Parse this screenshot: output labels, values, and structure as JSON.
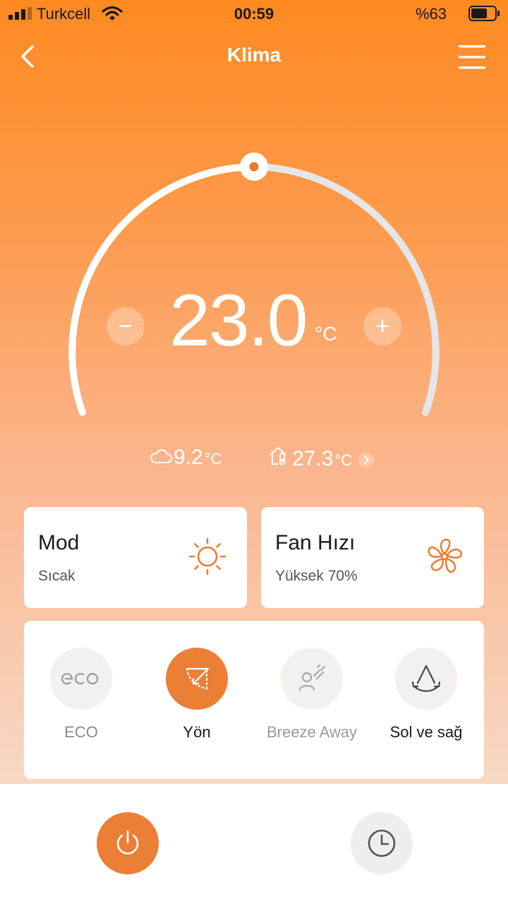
{
  "status_bar": {
    "carrier": "Turkcell",
    "time": "00:59",
    "battery": "%63"
  },
  "header": {
    "title": "Klima"
  },
  "thermostat": {
    "temperature": "23.0",
    "unit": "°C",
    "minus": "−",
    "plus": "+"
  },
  "environment": {
    "outdoor_temp": "9.2",
    "outdoor_unit": "°C",
    "indoor_temp": "27.3",
    "indoor_unit": "°C"
  },
  "mode_card": {
    "title": "Mod",
    "value": "Sıcak",
    "icon": "sun-icon"
  },
  "fan_card": {
    "title": "Fan Hızı",
    "value": "Yüksek 70%",
    "icon": "fan-icon"
  },
  "functions": [
    {
      "label": "ECO",
      "icon": "eco-icon",
      "active": false
    },
    {
      "label": "Yön",
      "icon": "direction-icon",
      "active": true
    },
    {
      "label": "Breeze Away",
      "icon": "breeze-away-icon",
      "active": false
    },
    {
      "label": "Sol ve sağ",
      "icon": "swing-left-right-icon",
      "active": false
    }
  ],
  "bottom_bar": {
    "power_icon": "power-icon",
    "timer_icon": "clock-icon"
  },
  "colors": {
    "accent": "#eb7f36",
    "header_gradient_top": "#ff8a22",
    "icon_orange": "#f07a2a"
  }
}
